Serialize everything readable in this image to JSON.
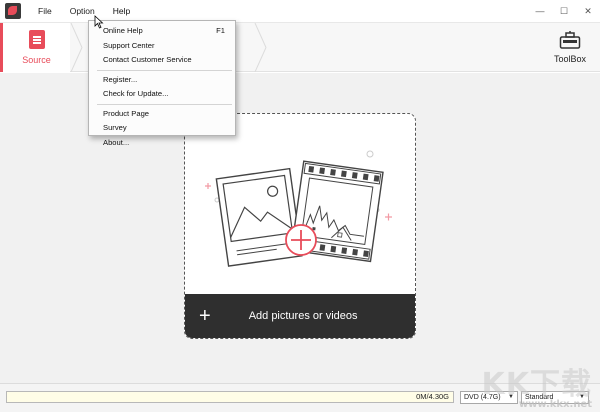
{
  "menubar": {
    "items": [
      "File",
      "Option",
      "Help"
    ]
  },
  "window_controls": {
    "minimize": "—",
    "maximize": "☐",
    "close": "✕"
  },
  "toolbar": {
    "source_label": "Source",
    "toolbox_label": "ToolBox"
  },
  "help_menu": {
    "online_help": "Online Help",
    "online_help_shortcut": "F1",
    "support_center": "Support Center",
    "contact_support": "Contact Customer Service",
    "register": "Register...",
    "check_update": "Check for Update...",
    "product_page": "Product Page",
    "survey": "Survey",
    "about": "About..."
  },
  "dropzone": {
    "label": "Add pictures or videos",
    "plus": "+"
  },
  "statusbar": {
    "capacity": "0M/4.30G",
    "disc_type": "DVD (4.7G)",
    "quality": "Standard"
  },
  "watermark": {
    "logo_text": "KK下载",
    "url": "www.kkx.net"
  },
  "colors": {
    "accent": "#e84c5a",
    "dark_bar": "#2f2f2f"
  }
}
